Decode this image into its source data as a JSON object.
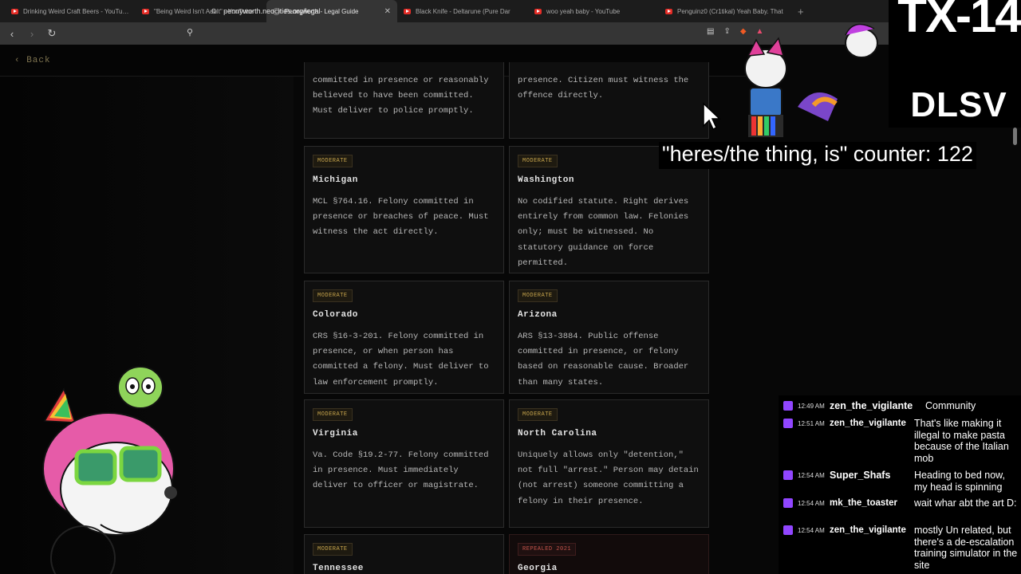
{
  "browser": {
    "tabs": [
      {
        "title": "Drinking Weird Craft Beers - YouTube",
        "icon": "youtube-icon",
        "active": false
      },
      {
        "title": "\"Being Weird Isn't Adult\" - YouTube",
        "icon": "youtube-icon",
        "active": false
      },
      {
        "title": "Pennyworth - Legal Guide",
        "icon": "globe-icon",
        "active": true
      },
      {
        "title": "Black Knife - Deltarune (Pure Dar",
        "icon": "youtube-icon",
        "active": false
      },
      {
        "title": "woo yeah baby - YouTube",
        "icon": "youtube-icon",
        "active": false
      },
      {
        "title": "Penguinz0 (Cr1tikal) Yeah Baby. That",
        "icon": "youtube-icon",
        "active": false
      }
    ],
    "url": "pennyworth.neocities.org/legal"
  },
  "page": {
    "back_label": "‹ Back",
    "cards": [
      {
        "badge": "",
        "state": "",
        "desc": "committed in presence or reasonably believed to have been committed. Must deliver to police promptly.",
        "partial": true
      },
      {
        "badge": "",
        "state": "",
        "desc": "presence. Citizen must witness the offence directly.",
        "partial": true
      },
      {
        "badge": "MODERATE",
        "state": "Michigan",
        "desc": "MCL §764.16. Felony committed in presence or breaches of peace. Must witness the act directly."
      },
      {
        "badge": "MODERATE",
        "state": "Washington",
        "desc": "No codified statute. Right derives entirely from common law. Felonies only; must be witnessed. No statutory guidance on force permitted."
      },
      {
        "badge": "MODERATE",
        "state": "Colorado",
        "desc": "CRS §16-3-201. Felony committed in presence, or when person has committed a felony. Must deliver to law enforcement promptly."
      },
      {
        "badge": "MODERATE",
        "state": "Arizona",
        "desc": "ARS §13-3884. Public offense committed in presence, or felony based on reasonable cause. Broader than many states."
      },
      {
        "badge": "MODERATE",
        "state": "Virginia",
        "desc": "Va. Code §19.2-77. Felony committed in presence. Must immediately deliver to officer or magistrate."
      },
      {
        "badge": "MODERATE",
        "state": "North Carolina",
        "desc": "Uniquely allows only \"detention,\" not full \"arrest.\" Person may detain (not arrest) someone committing a felony in their presence."
      },
      {
        "badge": "MODERATE",
        "state": "Tennessee",
        "desc": ""
      },
      {
        "badge": "REPEALED 2021",
        "state": "Georgia",
        "desc": "",
        "repealed": true
      }
    ]
  },
  "overlay": {
    "logo_top": "TX-14",
    "logo_bottom": "DLSV",
    "counter": "\"heres/the thing, is\" counter: 122"
  },
  "chat": [
    {
      "time": "12:49 AM",
      "user": "zen_the_vigilante",
      "text": "Community"
    },
    {
      "time": "12:51 AM",
      "user": "zen_the_vigilante",
      "text": "That's like making it illegal to make pasta because of the Italian mob"
    },
    {
      "time": "12:54 AM",
      "user": "Super_Shafs",
      "text": "Heading to bed now, my head is spinning"
    },
    {
      "time": "12:54 AM",
      "user": "mk_the_toaster",
      "text": "wait whar abt the art D:"
    },
    {
      "time": "12:54 AM",
      "user": "zen_the_vigilante",
      "text": "mostly Un related, but there's a de-escalation training simulator in the site"
    }
  ],
  "colors": {
    "badge_gold": "#c8a64d",
    "badge_red": "#c6544b",
    "twitch_purple": "#9146ff",
    "youtube_red": "#e52d27"
  }
}
